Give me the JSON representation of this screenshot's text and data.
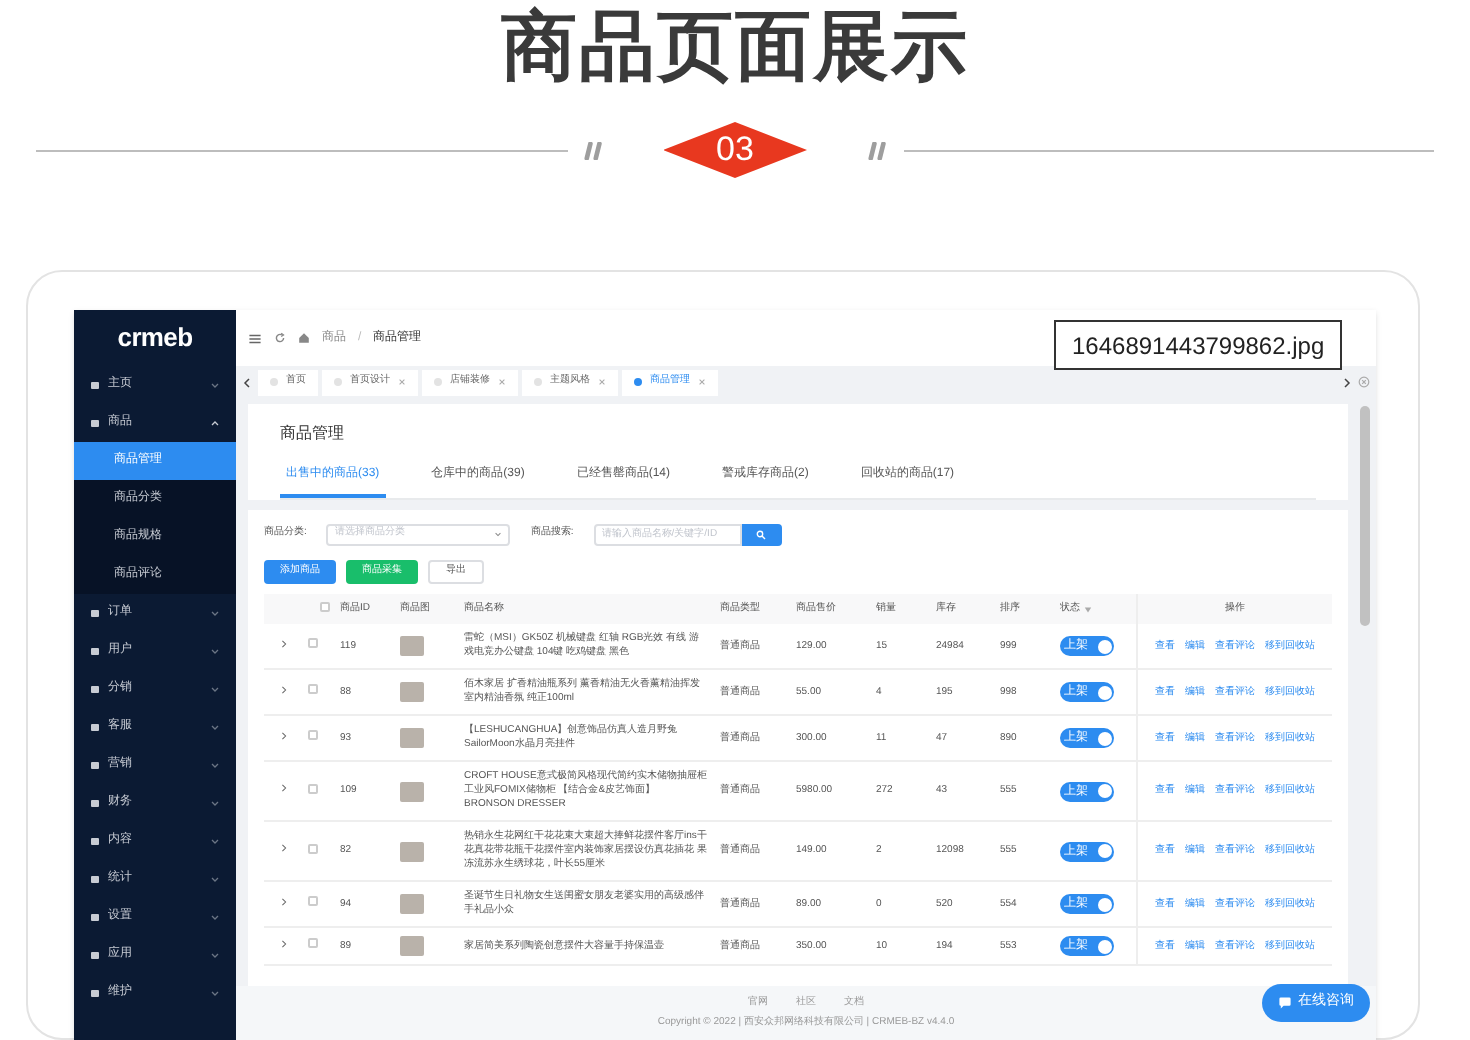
{
  "heading": "商品页面展示",
  "section_number": "03",
  "file_label": "1646891443799862.jpg",
  "app": {
    "logo": "crmeb",
    "sidebar": [
      {
        "label": "主页",
        "expanded": false
      },
      {
        "label": "商品",
        "expanded": true,
        "children": [
          {
            "label": "商品管理",
            "selected": true
          },
          {
            "label": "商品分类",
            "selected": false
          },
          {
            "label": "商品规格",
            "selected": false
          },
          {
            "label": "商品评论",
            "selected": false
          }
        ]
      },
      {
        "label": "订单",
        "expanded": false
      },
      {
        "label": "用户",
        "expanded": false
      },
      {
        "label": "分销",
        "expanded": false
      },
      {
        "label": "客服",
        "expanded": false
      },
      {
        "label": "营销",
        "expanded": false
      },
      {
        "label": "财务",
        "expanded": false
      },
      {
        "label": "内容",
        "expanded": false
      },
      {
        "label": "统计",
        "expanded": false
      },
      {
        "label": "设置",
        "expanded": false
      },
      {
        "label": "应用",
        "expanded": false
      },
      {
        "label": "维护",
        "expanded": false
      }
    ],
    "breadcrumb": [
      "商品",
      "商品管理"
    ],
    "breadcrumb_separator": "/",
    "tabs": [
      {
        "label": "首页",
        "selected": false,
        "closable": false
      },
      {
        "label": "首页设计",
        "selected": false,
        "closable": true
      },
      {
        "label": "店铺装修",
        "selected": false,
        "closable": true
      },
      {
        "label": "主题风格",
        "selected": false,
        "closable": true
      },
      {
        "label": "商品管理",
        "selected": true,
        "closable": true
      }
    ],
    "page_title": "商品管理",
    "product_tabs": [
      {
        "label": "出售中的商品(33)",
        "selected": true
      },
      {
        "label": "仓库中的商品(39)",
        "selected": false
      },
      {
        "label": "已经售罄商品(14)",
        "selected": false
      },
      {
        "label": "警戒库存商品(2)",
        "selected": false
      },
      {
        "label": "回收站的商品(17)",
        "selected": false
      }
    ],
    "filters": [
      {
        "kind": "select",
        "label": "商品分类:",
        "placeholder": "请选择商品分类"
      },
      {
        "kind": "search",
        "label": "商品搜索:",
        "placeholder": "请输入商品名称/关键字/ID"
      }
    ],
    "buttons": [
      {
        "kind": "primary",
        "label": "添加商品"
      },
      {
        "kind": "success",
        "label": "商品采集"
      },
      {
        "kind": "plain",
        "label": "导出"
      }
    ],
    "table": {
      "all_checked": false,
      "columns": [
        "商品ID",
        "商品图",
        "商品名称",
        "商品类型",
        "商品售价",
        "销量",
        "库存",
        "排序",
        "状态",
        "操作"
      ],
      "rows": [
        {
          "checked": false,
          "id": "119",
          "name": "雷蛇（MSI）GK50Z 机械键盘 红轴 RGB光效 有线 游戏电竞办公键盘 104键 吃鸡键盘 黑色",
          "type": "普通商品",
          "price": "129.00",
          "sales": "15",
          "stock": "24984",
          "sort": "999",
          "status": {
            "label": "上架",
            "on": true
          },
          "actions": [
            "查看",
            "编辑",
            "查看评论",
            "移到回收站"
          ]
        },
        {
          "checked": false,
          "id": "88",
          "name": "佰木家居 扩香精油瓶系列 薰香精油无火香薰精油挥发室内精油香氛 纯正100ml",
          "type": "普通商品",
          "price": "55.00",
          "sales": "4",
          "stock": "195",
          "sort": "998",
          "status": {
            "label": "上架",
            "on": true
          },
          "actions": [
            "查看",
            "编辑",
            "查看评论",
            "移到回收站"
          ]
        },
        {
          "checked": false,
          "id": "93",
          "name": "【LESHUCANGHUA】创意饰品仿真人造月野兔SailorMoon水晶月亮挂件",
          "type": "普通商品",
          "price": "300.00",
          "sales": "11",
          "stock": "47",
          "sort": "890",
          "status": {
            "label": "上架",
            "on": true
          },
          "actions": [
            "查看",
            "编辑",
            "查看评论",
            "移到回收站"
          ]
        },
        {
          "checked": false,
          "id": "109",
          "name": "CROFT HOUSE意式极简风格现代简约实木储物抽屉柜工业风FOMIX储物柜 【结合金&皮艺饰面】 BRONSON DRESSER",
          "type": "普通商品",
          "price": "5980.00",
          "sales": "272",
          "stock": "43",
          "sort": "555",
          "status": {
            "label": "上架",
            "on": true
          },
          "actions": [
            "查看",
            "编辑",
            "查看评论",
            "移到回收站"
          ]
        },
        {
          "checked": false,
          "id": "82",
          "name": "热销永生花网红干花花束大束超大捧鲜花摆件客厅ins干花真花带花瓶干花摆件室内装饰家居摆设仿真花插花 果冻流苏永生绣球花，叶长55厘米",
          "type": "普通商品",
          "price": "149.00",
          "sales": "2",
          "stock": "12098",
          "sort": "555",
          "status": {
            "label": "上架",
            "on": true
          },
          "actions": [
            "查看",
            "编辑",
            "查看评论",
            "移到回收站"
          ]
        },
        {
          "checked": false,
          "id": "94",
          "name": "圣诞节生日礼物女生送闺蜜女朋友老婆实用的高级感伴手礼品小众",
          "type": "普通商品",
          "price": "89.00",
          "sales": "0",
          "stock": "520",
          "sort": "554",
          "status": {
            "label": "上架",
            "on": true
          },
          "actions": [
            "查看",
            "编辑",
            "查看评论",
            "移到回收站"
          ]
        },
        {
          "checked": false,
          "id": "89",
          "name": "家居简美系列陶瓷创意摆件大容量手持保温壶",
          "type": "普通商品",
          "price": "350.00",
          "sales": "10",
          "stock": "194",
          "sort": "553",
          "status": {
            "label": "上架",
            "on": true
          },
          "actions": [
            "查看",
            "编辑",
            "查看评论",
            "移到回收站"
          ]
        }
      ]
    },
    "footer_links": [
      "官网",
      "社区",
      "文档"
    ],
    "copyright": "Copyright © 2022 | 西安众邦网络科技有限公司 | CRMEB-BZ v4.4.0",
    "chat_button": "在线咨询"
  }
}
